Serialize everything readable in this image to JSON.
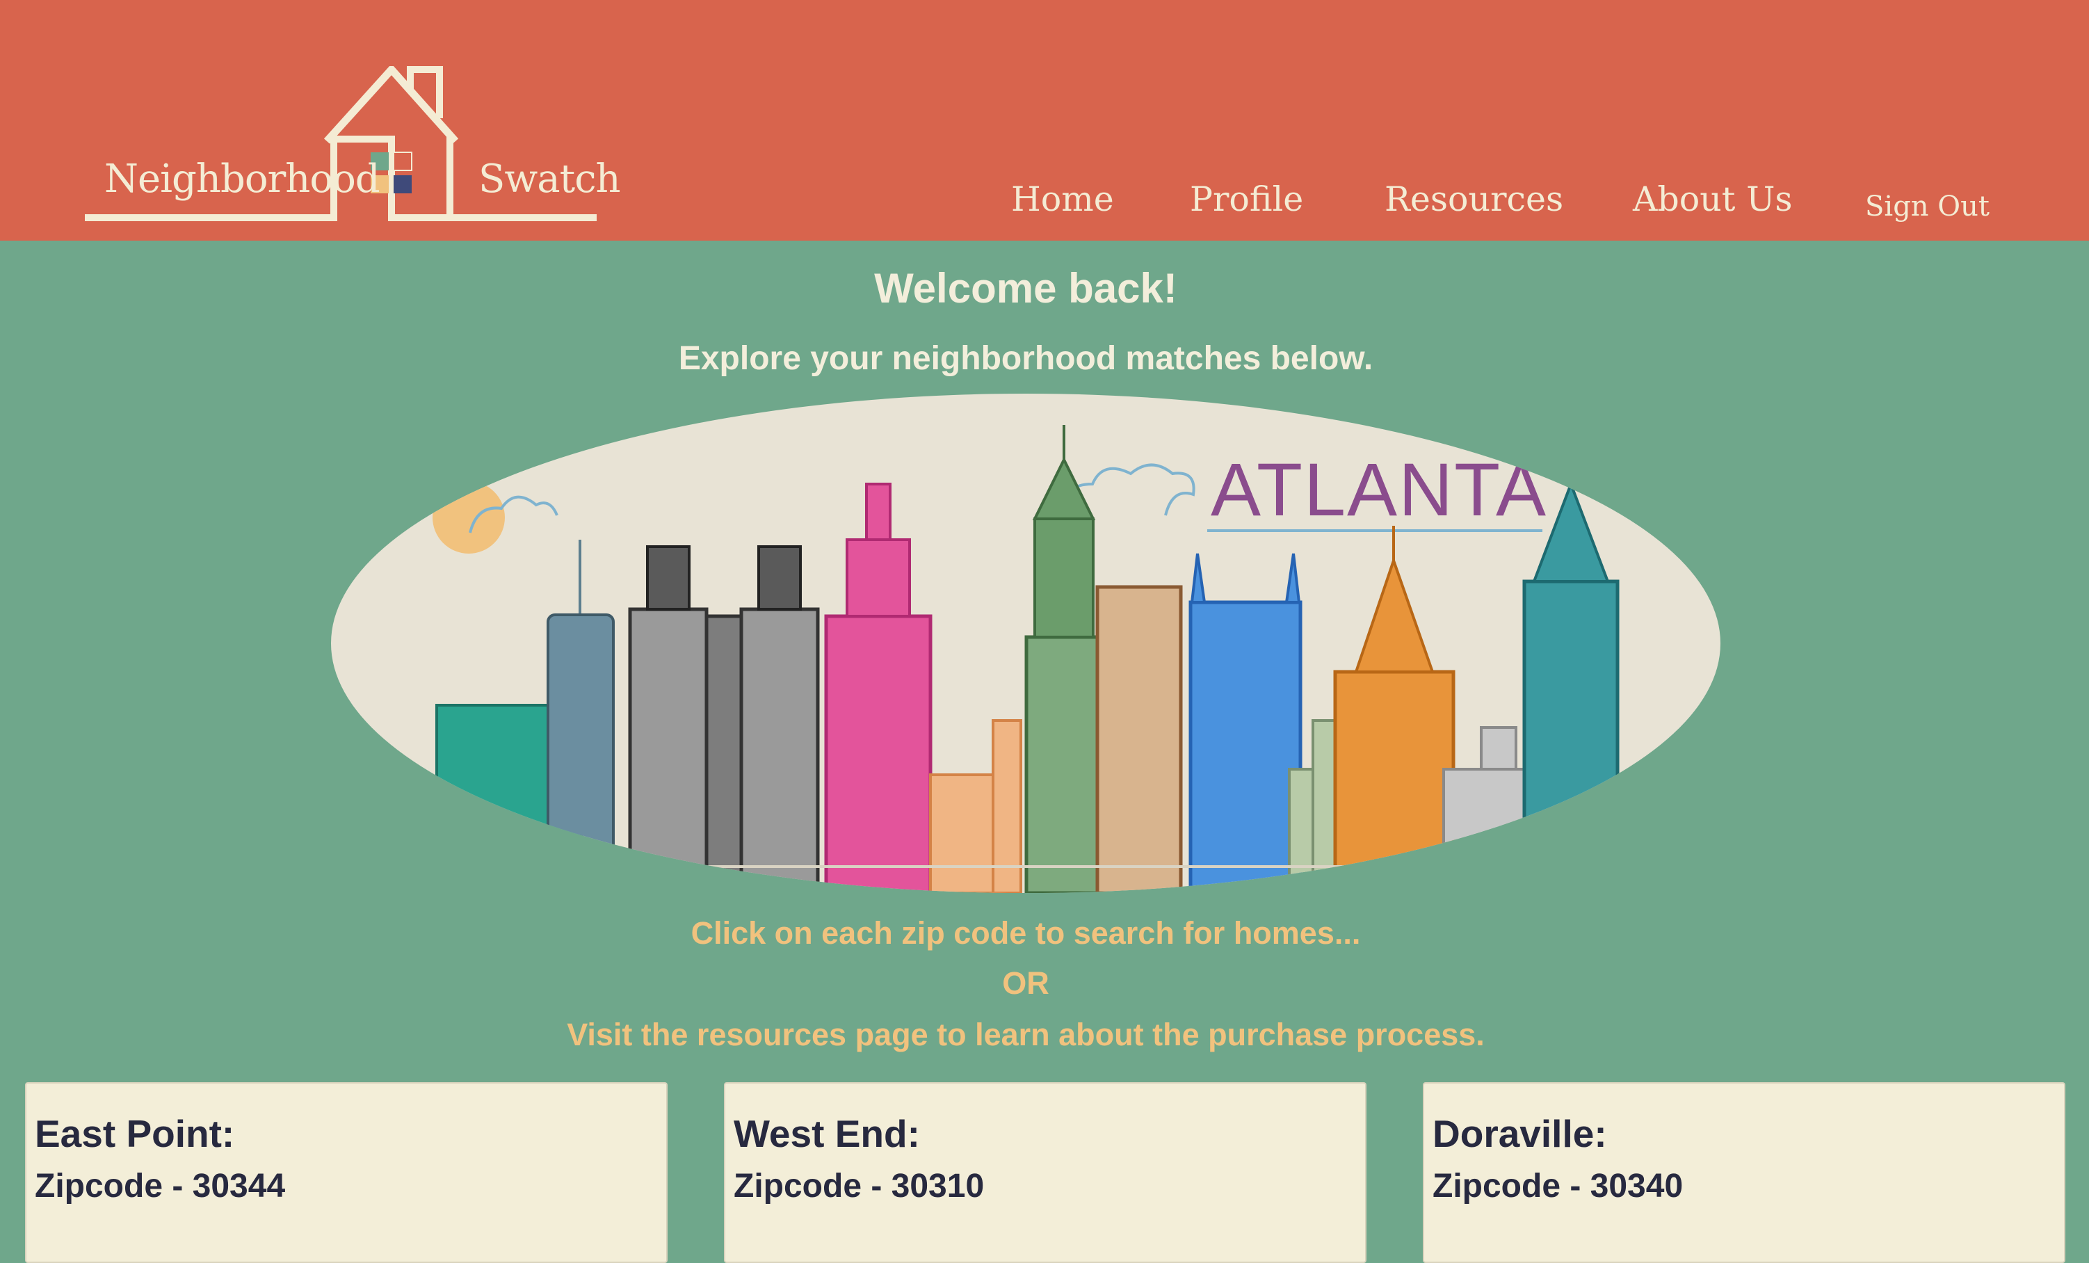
{
  "brand": {
    "name_left": "Neighborhood",
    "name_right": "Swatch",
    "colors": {
      "header": "#d8644d",
      "background": "#6fa78b",
      "cream": "#f4ecd4",
      "accent": "#f1c27e",
      "card": "#f3eed8"
    }
  },
  "nav": {
    "home": "Home",
    "profile": "Profile",
    "resources": "Resources",
    "about": "About Us",
    "signout": "Sign Out"
  },
  "main": {
    "welcome": "Welcome back!",
    "explore": "Explore your neighborhood matches below.",
    "hero_title": "ATLANTA",
    "instruction_1": "Click on each zip code to search for homes...",
    "instruction_or": "OR",
    "instruction_2": "Visit the resources page to learn about the purchase process."
  },
  "cards": [
    {
      "name": "East Point:",
      "zip": "Zipcode - 30344"
    },
    {
      "name": "West End:",
      "zip": "Zipcode - 30310"
    },
    {
      "name": "Doraville:",
      "zip": "Zipcode - 30340"
    }
  ]
}
